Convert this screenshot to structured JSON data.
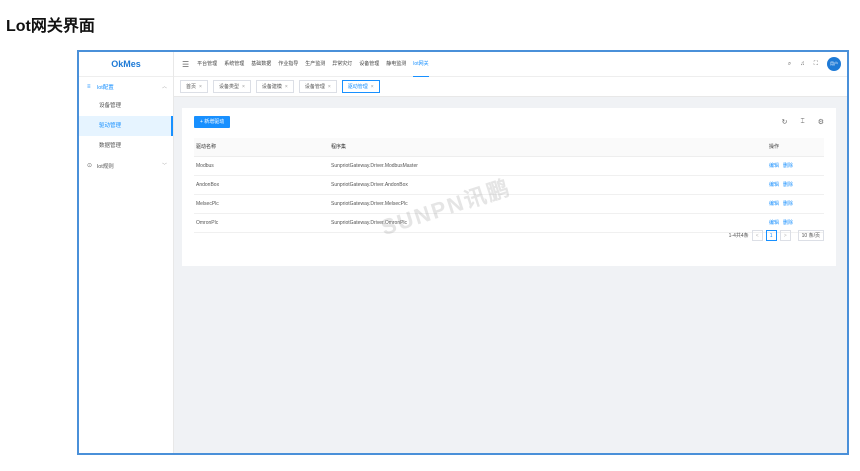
{
  "page_heading": "Lot网关界面",
  "app": {
    "logo": "OkMes"
  },
  "sidebar": {
    "groups": [
      {
        "label": "lot配置",
        "icon": "menu-lines-icon",
        "expanded": true,
        "items": [
          {
            "label": "设备管理"
          },
          {
            "label": "驱动管理"
          },
          {
            "label": "数据管理"
          }
        ]
      },
      {
        "label": "lot规则",
        "icon": "rule-icon",
        "expanded": false
      }
    ]
  },
  "topnav": {
    "items": [
      "平台管理",
      "系统管理",
      "基础数据",
      "作业指导",
      "生产监测",
      "异常灾灯",
      "设备管理",
      "静电监测",
      "lot网关"
    ]
  },
  "user": {
    "avatar_text": "用户"
  },
  "tabs": [
    {
      "label": "首页"
    },
    {
      "label": "设备类型"
    },
    {
      "label": "设备建模"
    },
    {
      "label": "设备管理"
    },
    {
      "label": "驱动管理"
    }
  ],
  "toolbar": {
    "add_label": "+ 新增驱动"
  },
  "table": {
    "columns": [
      "驱动名称",
      "程序集",
      "操作"
    ],
    "rows": [
      {
        "name": "Modbus",
        "assembly": "SunpriotGateway.Driver.ModbusMaster"
      },
      {
        "name": "AndonBox",
        "assembly": "SunpriotGateway.Driver.AndonBox"
      },
      {
        "name": "MelsecPlc",
        "assembly": "SunpriotGateway.Driver.MelsecPlc"
      },
      {
        "name": "OmronPlc",
        "assembly": "SunpriotGateway.Driver.OmronPlc"
      }
    ],
    "actions": {
      "edit": "编辑",
      "delete": "删除"
    }
  },
  "pagination": {
    "summary": "1-4共4条",
    "prev": "<",
    "page": "1",
    "next": ">",
    "page_size": "10 条/页"
  },
  "watermark": "SUNPN讯鹏",
  "colors": {
    "accent": "#1890ff",
    "frame": "#4a90d9"
  }
}
